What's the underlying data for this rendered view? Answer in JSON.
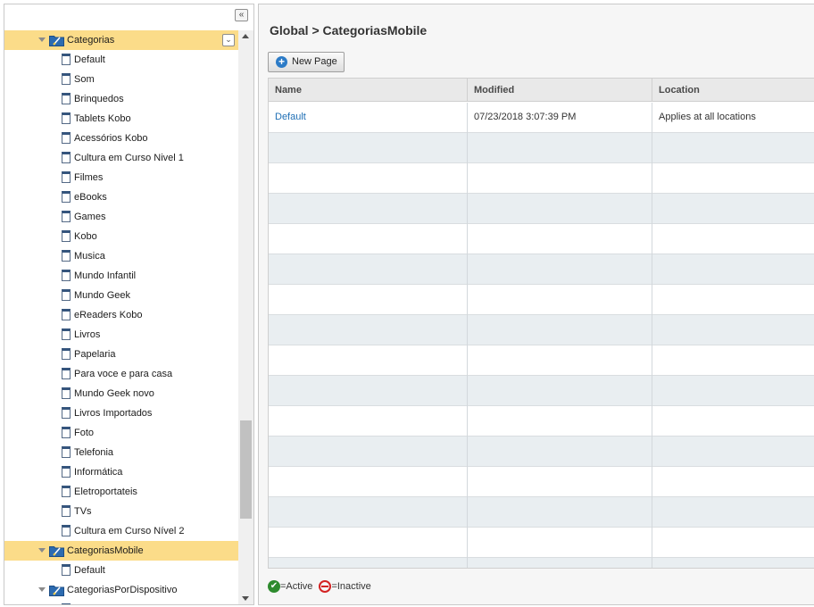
{
  "tree": {
    "collapse_glyph": "«",
    "folder_option_glyph": "⌄",
    "items": [
      {
        "label": "Categorias",
        "type": "folder",
        "selected": true
      },
      {
        "label": "Default",
        "type": "page"
      },
      {
        "label": "Som",
        "type": "page"
      },
      {
        "label": "Brinquedos",
        "type": "page"
      },
      {
        "label": "Tablets Kobo",
        "type": "page"
      },
      {
        "label": "Acessórios Kobo",
        "type": "page"
      },
      {
        "label": "Cultura em Curso Nivel 1",
        "type": "page"
      },
      {
        "label": "Filmes",
        "type": "page"
      },
      {
        "label": "eBooks",
        "type": "page"
      },
      {
        "label": "Games",
        "type": "page"
      },
      {
        "label": "Kobo",
        "type": "page"
      },
      {
        "label": "Musica",
        "type": "page"
      },
      {
        "label": "Mundo Infantil",
        "type": "page"
      },
      {
        "label": "Mundo Geek",
        "type": "page"
      },
      {
        "label": "eReaders Kobo",
        "type": "page"
      },
      {
        "label": "Livros",
        "type": "page"
      },
      {
        "label": "Papelaria",
        "type": "page"
      },
      {
        "label": "Para voce e para casa",
        "type": "page"
      },
      {
        "label": "Mundo Geek novo",
        "type": "page"
      },
      {
        "label": "Livros Importados",
        "type": "page"
      },
      {
        "label": "Foto",
        "type": "page"
      },
      {
        "label": "Telefonia",
        "type": "page"
      },
      {
        "label": "Informática",
        "type": "page"
      },
      {
        "label": "Eletroportateis",
        "type": "page"
      },
      {
        "label": "TVs",
        "type": "page"
      },
      {
        "label": "Cultura em Curso Nível 2",
        "type": "page"
      },
      {
        "label": "CategoriasMobile",
        "type": "folder",
        "selected": true
      },
      {
        "label": "Default",
        "type": "page"
      },
      {
        "label": "CategoriasPorDispositivo",
        "type": "folder"
      },
      {
        "label": "",
        "type": "page"
      }
    ]
  },
  "main": {
    "breadcrumb": "Global > CategoriasMobile",
    "new_page_label": "New Page",
    "table": {
      "headers": [
        "Name",
        "Modified",
        "Location"
      ],
      "rows": [
        [
          "Default",
          "07/23/2018 3:07:39 PM",
          "Applies at all locations"
        ]
      ],
      "empty_row_count": 15
    },
    "legend": {
      "active_label": "=Active",
      "inactive_label": "=Inactive"
    }
  },
  "colors": {
    "selected_row": "#fbdc89",
    "link": "#1f6fb5",
    "active": "#2e8b2e",
    "inactive": "#d32222",
    "folder": "#2c6bb0"
  }
}
